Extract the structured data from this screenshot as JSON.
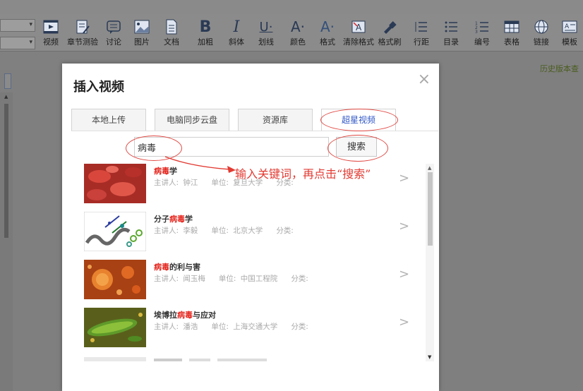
{
  "toolbar": {
    "buttons": [
      {
        "label": "视频",
        "icon": "video-icon"
      },
      {
        "label": "章节测验",
        "icon": "quiz-icon"
      },
      {
        "label": "讨论",
        "icon": "discussion-icon"
      },
      {
        "label": "图片",
        "icon": "image-icon"
      },
      {
        "label": "文档",
        "icon": "document-icon"
      },
      {
        "label": "加粗",
        "icon": "bold-icon",
        "glyph": "B"
      },
      {
        "label": "斜体",
        "icon": "italic-icon",
        "glyph": "I"
      },
      {
        "label": "划线",
        "icon": "underline-icon",
        "glyph": "U·"
      },
      {
        "label": "颜色",
        "icon": "font-color-icon",
        "glyph": "A·"
      },
      {
        "label": "格式",
        "icon": "font-format-icon",
        "glyph": "A·"
      },
      {
        "label": "清除格式",
        "icon": "clear-format-icon",
        "glyph": "A"
      },
      {
        "label": "格式刷",
        "icon": "format-painter-icon"
      },
      {
        "label": "行距",
        "icon": "line-spacing-icon"
      },
      {
        "label": "目录",
        "icon": "toc-icon"
      },
      {
        "label": "编号",
        "icon": "numbering-icon"
      },
      {
        "label": "表格",
        "icon": "table-icon"
      },
      {
        "label": "链接",
        "icon": "link-icon"
      },
      {
        "label": "模板",
        "icon": "template-icon"
      }
    ]
  },
  "header": {
    "history_link": "历史版本查"
  },
  "dialog": {
    "title": "插入视频",
    "close_glyph": "×",
    "tabs": [
      "本地上传",
      "电脑同步云盘",
      "资源库",
      "超星视频"
    ],
    "active_tab": "超星视频",
    "search": {
      "value": "病毒",
      "button": "搜索"
    },
    "annotation": "输入关键词，再点击“搜索”",
    "arrow_glyph": ">",
    "results": [
      {
        "pre": "",
        "kw": "病毒",
        "post": "学",
        "lecturer_label": "主讲人:",
        "lecturer": "钟江",
        "unit_label": "单位:",
        "unit": "复旦大学",
        "category_label": "分类:",
        "thumb": "red-cells-thumbnail"
      },
      {
        "pre": "分子",
        "kw": "病毒",
        "post": "学",
        "lecturer_label": "主讲人:",
        "lecturer": "李毅",
        "unit_label": "单位:",
        "unit": "北京大学",
        "category_label": "分类:",
        "thumb": "molecule-thumbnail"
      },
      {
        "pre": "",
        "kw": "病毒",
        "post": "的利与害",
        "lecturer_label": "主讲人:",
        "lecturer": "闻玉梅",
        "unit_label": "单位:",
        "unit": "中国工程院",
        "category_label": "分类:",
        "thumb": "virus-orange-thumbnail"
      },
      {
        "pre": "埃博拉",
        "kw": "病毒",
        "post": "与应对",
        "lecturer_label": "主讲人:",
        "lecturer": "潘浩",
        "unit_label": "单位:",
        "unit": "上海交通大学",
        "category_label": "分类:",
        "thumb": "bacteria-green-thumbnail"
      }
    ]
  },
  "colors": {
    "keyword": "#e5231b",
    "annotation": "#e23a32",
    "active_tab": "#2f56c7",
    "overlay": "#808080"
  }
}
